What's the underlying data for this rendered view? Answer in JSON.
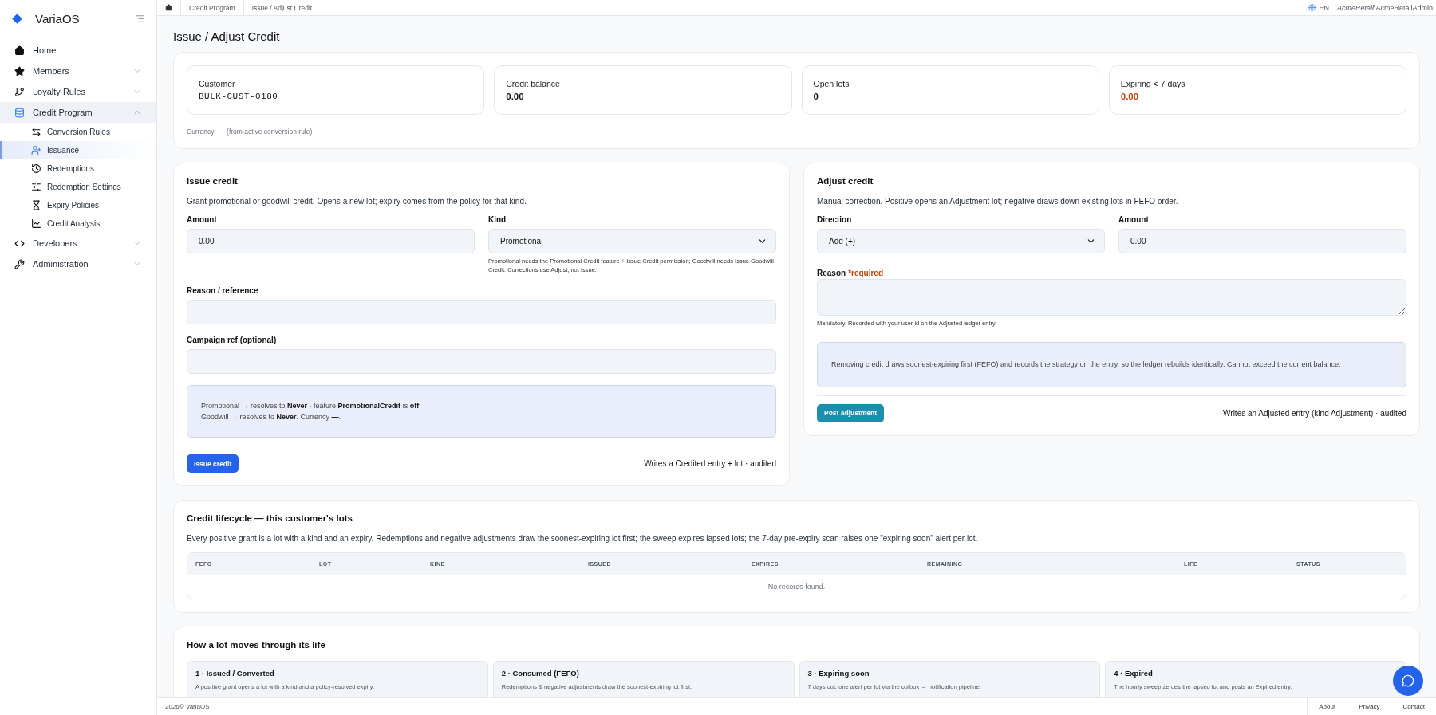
{
  "sidebar": {
    "brand": "VariaOS",
    "items": [
      {
        "label": "Home",
        "kind": "link",
        "selected": false
      },
      {
        "label": "Members",
        "kind": "group",
        "expanded": false,
        "selected": false
      },
      {
        "label": "Loyalty Rules",
        "kind": "group",
        "expanded": false,
        "selected": false
      },
      {
        "label": "Credit Program",
        "kind": "group",
        "expanded": true,
        "selected": true,
        "children": [
          {
            "label": "Conversion Rules",
            "selected": false
          },
          {
            "label": "Issuance",
            "selected": true
          },
          {
            "label": "Redemptions",
            "selected": false
          },
          {
            "label": "Redemption Settings",
            "selected": false
          },
          {
            "label": "Expiry Policies",
            "selected": false
          },
          {
            "label": "Credit Analysis",
            "selected": false
          }
        ]
      },
      {
        "label": "Developers",
        "kind": "group",
        "expanded": false,
        "selected": false
      },
      {
        "label": "Administration",
        "kind": "group",
        "expanded": false,
        "selected": false
      }
    ]
  },
  "breadcrumbs": [
    "Credit Program",
    "Issue / Adjust Credit"
  ],
  "topbar": {
    "language": "EN",
    "tenant": "AcmeRetail",
    "user": "\\AcmeRetailAdmin"
  },
  "page_title": "Issue / Adjust Credit",
  "summary": {
    "cards": [
      {
        "label": "Customer",
        "value": "BULK-CUST-0180",
        "kind": "mono"
      },
      {
        "label": "Credit balance",
        "value": "0.00",
        "kind": "number"
      },
      {
        "label": "Open lots",
        "value": "0",
        "kind": "number"
      },
      {
        "label": "Expiring < 7 days",
        "value": "0.00",
        "kind": "warning"
      }
    ],
    "currency_note": "Currency: **—** (from active conversion rule)"
  },
  "issue": {
    "title": "Issue credit",
    "description": "Grant promotional or goodwill credit. Opens a new lot; expiry comes from the policy for that kind.",
    "amount": {
      "label": "Amount",
      "value": "0.00"
    },
    "kind": {
      "label": "Kind",
      "value": "Promotional",
      "help": "Promotional needs the Promotional Credit feature + Issue Credit permission; Goodwill needs Issue Goodwill Credit. Corrections use Adjust, not Issue."
    },
    "reason": {
      "label": "Reason / reference"
    },
    "campaign": {
      "label": "Campaign ref (optional)"
    },
    "info": [
      "Promotional → resolves to **Never** · feature **PromotionalCredit** is **off**.",
      "Goodwill → resolves to **Never**. Currency **—**."
    ],
    "button": "Issue credit",
    "note": "Writes a Credited entry + lot · audited"
  },
  "adjust": {
    "title": "Adjust credit",
    "description": "Manual correction. Positive opens an Adjustment lot; negative draws down existing lots in FEFO order.",
    "direction": {
      "label": "Direction",
      "value": "Add (+)"
    },
    "amount": {
      "label": "Amount",
      "value": "0.00"
    },
    "reason": {
      "label": "Reason",
      "required_mark": "*required",
      "help": "Mandatory. Recorded with your user id on the Adjusted ledger entry."
    },
    "info": "Removing credit draws soonest-expiring first (FEFO) and records the strategy on the entry, so the ledger rebuilds identically. Cannot exceed the current balance.",
    "button": "Post adjustment",
    "note": "Writes an Adjusted entry (kind Adjustment) · audited"
  },
  "lifecycle": {
    "title": "Credit lifecycle — this customer's lots",
    "description": "Every positive grant is a lot with a kind and an expiry. Redemptions and negative adjustments draw the soonest-expiring lot first; the sweep expires lapsed lots; the 7-day pre-expiry scan raises one \"expiring soon\" alert per lot.",
    "table": {
      "columns": [
        "FEFO",
        "LOT",
        "KIND",
        "ISSUED",
        "EXPIRES",
        "REMAINING",
        "LIFE",
        "STATUS"
      ],
      "empty": "No records found."
    }
  },
  "stages": {
    "title": "How a lot moves through its life",
    "items": [
      {
        "title": "1 · Issued / Converted",
        "text": "A positive grant opens a lot with a kind and a policy-resolved expiry."
      },
      {
        "title": "2 · Consumed (FEFO)",
        "text": "Redemptions & negative adjustments draw the soonest-expiring lot first."
      },
      {
        "title": "3 · Expiring soon",
        "text": "7 days out, one alert per lot via the outbox → notification pipeline."
      },
      {
        "title": "4 · Expired",
        "text": "The hourly sweep zeroes the lapsed lot and posts an Expired entry."
      }
    ]
  },
  "footer": {
    "copyright": "2026© VariaOS",
    "links": [
      "About",
      "Privacy",
      "Contact"
    ]
  }
}
